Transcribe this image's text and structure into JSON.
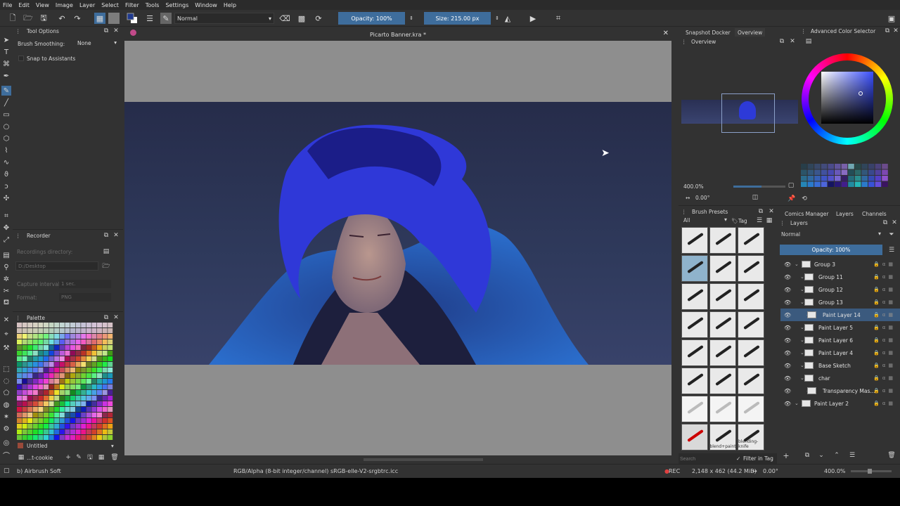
{
  "menu": [
    "File",
    "Edit",
    "View",
    "Image",
    "Layer",
    "Select",
    "Filter",
    "Tools",
    "Settings",
    "Window",
    "Help"
  ],
  "toolbar": {
    "blend_mode": "Normal",
    "opacity": "Opacity: 100%",
    "size": "Size: 215.00 px"
  },
  "tool_options": {
    "title": "Tool Options",
    "brush_smoothing_label": "Brush Smoothing:",
    "brush_smoothing_value": "None",
    "snap_label": "Snap to Assistants"
  },
  "recorder": {
    "title": "Recorder",
    "dir_label": "Recordings directory:",
    "dir_value": "D:/Desktop",
    "interval_label": "Capture interval:",
    "interval_value": "1 sec.",
    "format_label": "Format:",
    "format_value": "PNG"
  },
  "palette": {
    "title": "Palette",
    "name": "Untitled",
    "set": "...t-cookie"
  },
  "document": {
    "title": "Picarto Banner.kra *"
  },
  "overview": {
    "tab1": "Snapshot Docker",
    "tab2": "Overview",
    "title": "Overview",
    "zoom": "400.0%",
    "rotation": "0.00°"
  },
  "color_selector": {
    "title": "Advanced Color Selector"
  },
  "brush_presets": {
    "title": "Brush Presets",
    "filter": "All",
    "tag_label": "Tag",
    "search_placeholder": "Search",
    "filter_in_tag": "Filter in Tag",
    "presets": [
      "",
      "",
      "",
      "",
      "",
      "",
      "",
      "",
      "",
      "",
      "",
      "",
      "",
      "",
      "",
      "",
      "",
      "",
      "",
      "",
      "",
      "",
      "blend+paint",
      "blending-knife"
    ]
  },
  "layers": {
    "tabs": [
      "Comics Manager",
      "Layers",
      "Channels"
    ],
    "title": "Layers",
    "blend": "Normal",
    "opacity": "Opacity:  100%",
    "items": [
      {
        "name": "Group 3",
        "indent": 0
      },
      {
        "name": "Group 11",
        "indent": 1
      },
      {
        "name": "Group 12",
        "indent": 1
      },
      {
        "name": "Group 13",
        "indent": 1
      },
      {
        "name": "Paint Layer 14",
        "indent": 2,
        "selected": true
      },
      {
        "name": "Paint Layer 5",
        "indent": 1
      },
      {
        "name": "Paint Layer 6",
        "indent": 1
      },
      {
        "name": "Paint Layer 4",
        "indent": 1
      },
      {
        "name": "Base Sketch",
        "indent": 1
      },
      {
        "name": "char",
        "indent": 1
      },
      {
        "name": "Transparency Mas...",
        "indent": 2
      },
      {
        "name": "Paint Layer 2",
        "indent": 0
      }
    ]
  },
  "status": {
    "brush": "b) Airbrush Soft",
    "color_info": "RGB/Alpha (8-bit integer/channel)  sRGB-elle-V2-srgbtrc.icc",
    "rec": "REC",
    "dims": "2,148 x 462 (44.2 MiB)",
    "angle": "0.00°",
    "zoom": "400.0%"
  },
  "colors": {
    "accent": "#3e6d9c",
    "selected_layer": "#3b5a7e",
    "panel_bg": "#323232",
    "canvas_bg": "#8e8e8e"
  }
}
